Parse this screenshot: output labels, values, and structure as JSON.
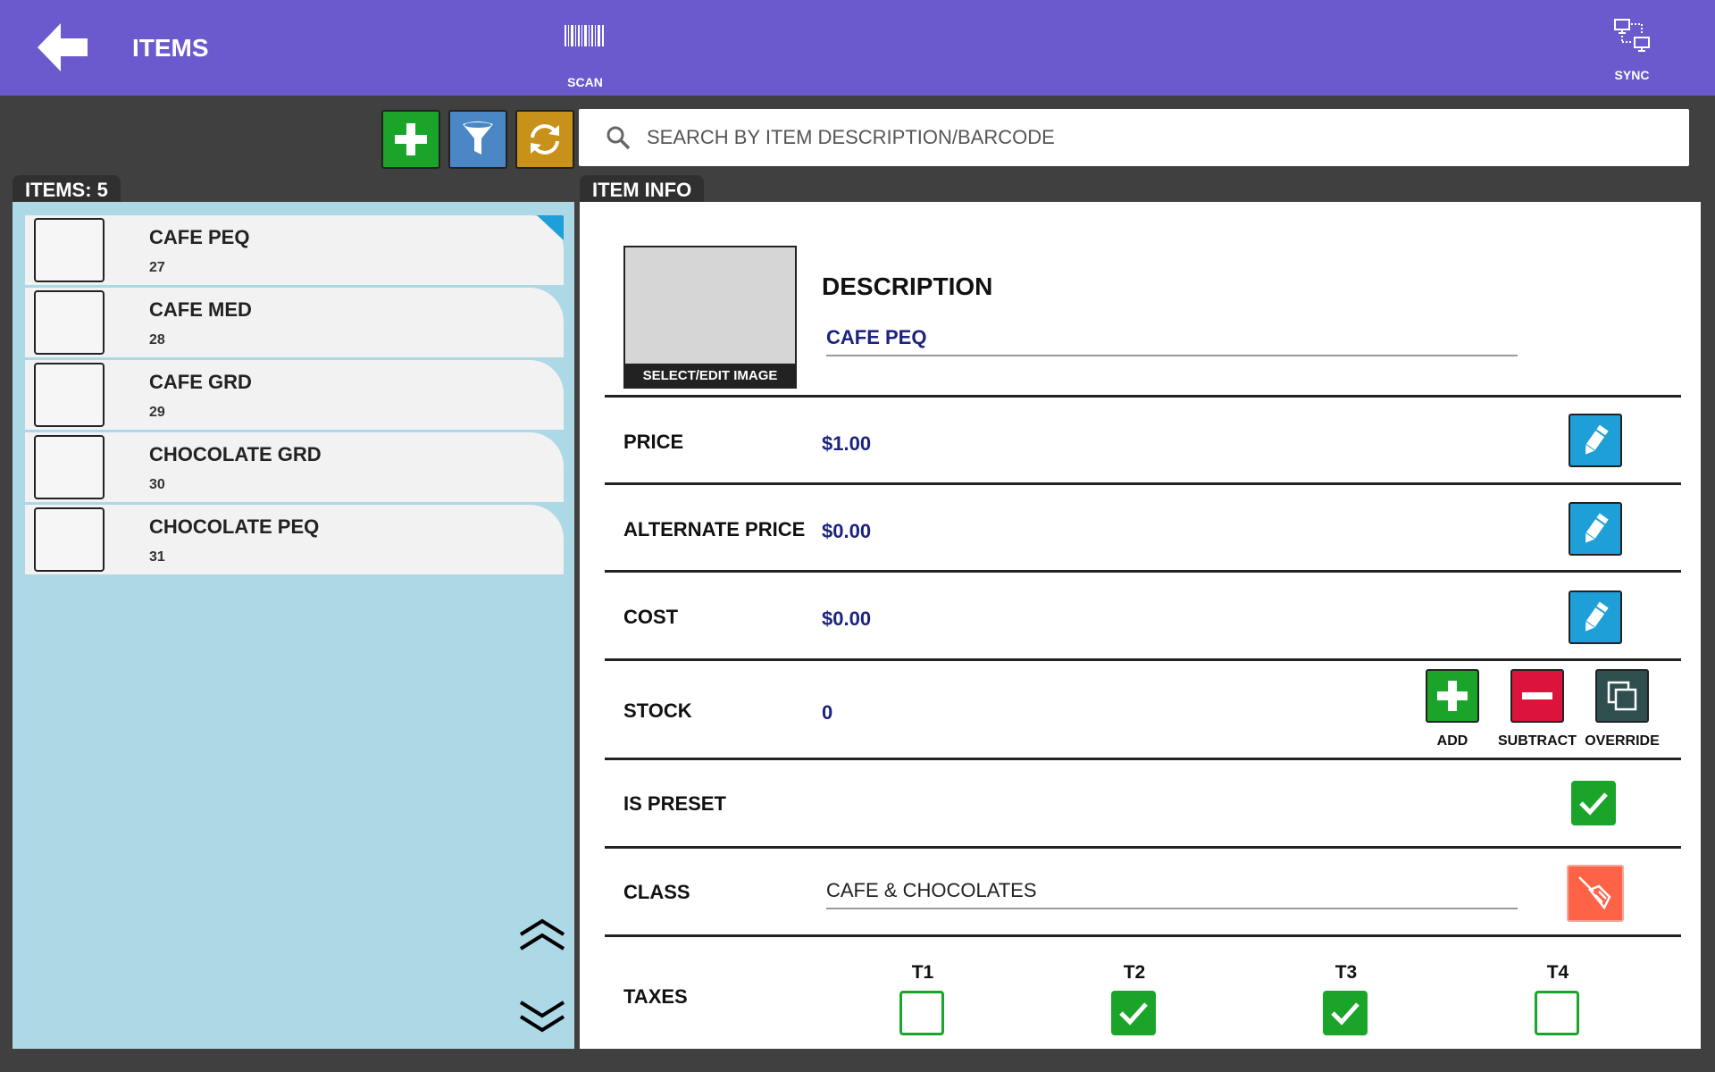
{
  "header": {
    "title": "ITEMS",
    "scan_label": "SCAN",
    "sync_label": "SYNC",
    "bg_color": "#6a5acd"
  },
  "toolbar": {
    "add_icon": "plus-icon",
    "filter_icon": "filter-icon",
    "refresh_icon": "refresh-icon"
  },
  "search": {
    "placeholder": "SEARCH BY ITEM DESCRIPTION/BARCODE",
    "value": ""
  },
  "item_list": {
    "header": "ITEMS: 5",
    "items": [
      {
        "name": "CAFE PEQ",
        "code": "27",
        "selected": true
      },
      {
        "name": "CAFE MED",
        "code": "28",
        "selected": false
      },
      {
        "name": "CAFE GRD",
        "code": "29",
        "selected": false
      },
      {
        "name": "CHOCOLATE GRD",
        "code": "30",
        "selected": false
      },
      {
        "name": "CHOCOLATE PEQ",
        "code": "31",
        "selected": false
      }
    ]
  },
  "item_info": {
    "header": "ITEM INFO",
    "image_caption": "SELECT/EDIT IMAGE",
    "description_label": "DESCRIPTION",
    "description_value": "CAFE PEQ",
    "price_label": "PRICE",
    "price_value": "$1.00",
    "alt_price_label": "ALTERNATE PRICE",
    "alt_price_value": "$0.00",
    "cost_label": "COST",
    "cost_value": "$0.00",
    "stock_label": "STOCK",
    "stock_value": "0",
    "stock_add_label": "ADD",
    "stock_subtract_label": "SUBTRACT",
    "stock_override_label": "OVERRIDE",
    "is_preset_label": "IS PRESET",
    "is_preset": true,
    "class_label": "CLASS",
    "class_value": "CAFE & CHOCOLATES",
    "taxes_label": "TAXES",
    "taxes": [
      {
        "label": "T1",
        "checked": false
      },
      {
        "label": "T2",
        "checked": true
      },
      {
        "label": "T3",
        "checked": true
      },
      {
        "label": "T4",
        "checked": false
      }
    ]
  }
}
